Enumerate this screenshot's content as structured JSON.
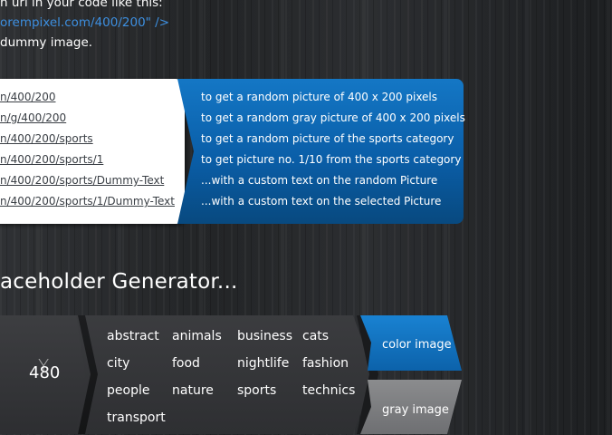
{
  "intro": {
    "line1": "n url in your code like this:",
    "line2": "orempixel.com/400/200\" />",
    "line3": "dummy image."
  },
  "examples": [
    {
      "url": "n/400/200",
      "desc": "to get a random picture of 400 x 200 pixels"
    },
    {
      "url": "n/g/400/200",
      "desc": "to get a random gray picture of 400 x 200 pixels"
    },
    {
      "url": "n/400/200/sports",
      "desc": "to get a random picture of the sports category"
    },
    {
      "url": "n/400/200/sports/1",
      "desc": "to get picture no. 1/10 from the sports category"
    },
    {
      "url": "n/400/200/sports/Dummy-Text",
      "desc": "...with a custom text on the random Picture"
    },
    {
      "url": "n/400/200/sports/1/Dummy-Text",
      "desc": "...with a custom text on the selected Picture"
    }
  ],
  "generator": {
    "title": "aceholder Generator...",
    "y_label": "Y",
    "size_value": "480",
    "categories": [
      [
        "abstract",
        "animals",
        "business",
        "cats"
      ],
      [
        "city",
        "food",
        "nightlife",
        "fashion"
      ],
      [
        "people",
        "nature",
        "sports",
        "technics"
      ],
      [
        "transport"
      ]
    ],
    "color_option": "color image",
    "gray_option": "gray image"
  },
  "colors": {
    "accent_blue": "#0c62aa",
    "link_blue": "#3d8fe0",
    "gray_option": "#7a7b7d"
  }
}
